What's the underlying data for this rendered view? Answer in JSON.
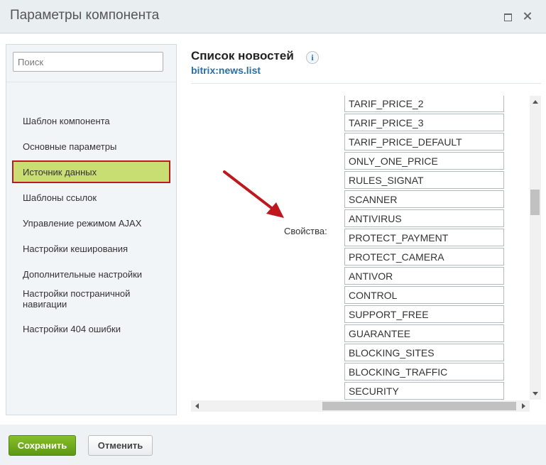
{
  "window": {
    "title": "Параметры компонента",
    "maximize_icon": "maximize-icon",
    "close_icon": "close-icon"
  },
  "sidebar": {
    "search_placeholder": "Поиск",
    "items": [
      {
        "label": "Шаблон компонента",
        "active": false
      },
      {
        "label": "Основные параметры",
        "active": false
      },
      {
        "label": "Источник данных",
        "active": true
      },
      {
        "label": "Шаблоны ссылок",
        "active": false
      },
      {
        "label": "Управление режимом AJAX",
        "active": false
      },
      {
        "label": "Настройки кеширования",
        "active": false
      },
      {
        "label": "Дополнительные настройки",
        "active": false
      },
      {
        "label": "Настройки постраничной навигации",
        "active": false
      },
      {
        "label": "Настройки 404 ошибки",
        "active": false
      }
    ]
  },
  "main": {
    "title": "Список новостей",
    "info_icon": "i",
    "component_code": "bitrix:news.list",
    "property_label": "Свойства:",
    "properties": [
      "TARIF_PRICE_2",
      "TARIF_PRICE_3",
      "TARIF_PRICE_DEFAULT",
      "ONLY_ONE_PRICE",
      "RULES_SIGNAT",
      "SCANNER",
      "ANTIVIRUS",
      "PROTECT_PAYMENT",
      "PROTECT_CAMERA",
      "ANTIVOR",
      "CONTROL",
      "SUPPORT_FREE",
      "GUARANTEE",
      "BLOCKING_SITES",
      "BLOCKING_TRAFFIC",
      "SECURITY"
    ]
  },
  "footer": {
    "save_label": "Сохранить",
    "cancel_label": "Отменить"
  },
  "colors": {
    "active_item_bg": "#c9de72",
    "active_item_border": "#b81c22",
    "save_button": "#6aa61c",
    "link_blue": "#2a6fa6",
    "arrow": "#c0171e"
  }
}
